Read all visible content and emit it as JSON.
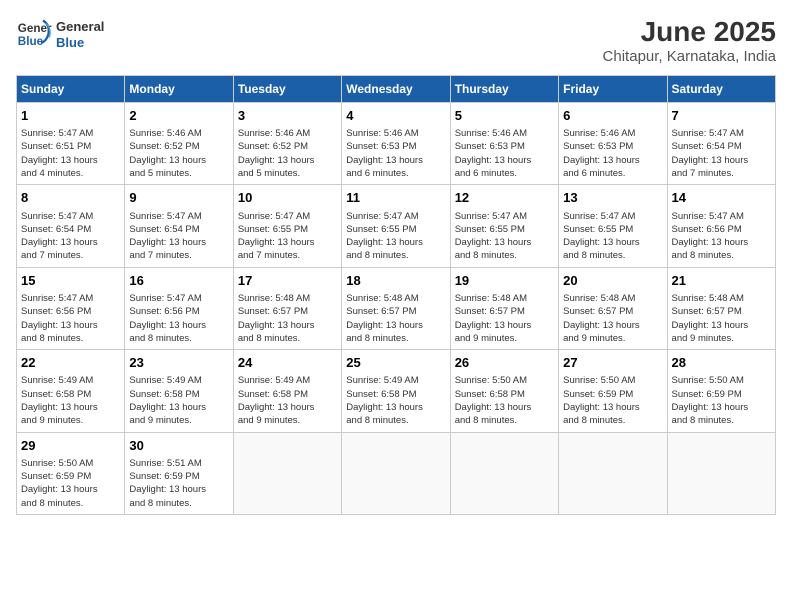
{
  "header": {
    "logo_line1": "General",
    "logo_line2": "Blue",
    "title": "June 2025",
    "subtitle": "Chitapur, Karnataka, India"
  },
  "calendar": {
    "weekdays": [
      "Sunday",
      "Monday",
      "Tuesday",
      "Wednesday",
      "Thursday",
      "Friday",
      "Saturday"
    ],
    "weeks": [
      [
        {
          "day": "1",
          "info": "Sunrise: 5:47 AM\nSunset: 6:51 PM\nDaylight: 13 hours\nand 4 minutes."
        },
        {
          "day": "2",
          "info": "Sunrise: 5:46 AM\nSunset: 6:52 PM\nDaylight: 13 hours\nand 5 minutes."
        },
        {
          "day": "3",
          "info": "Sunrise: 5:46 AM\nSunset: 6:52 PM\nDaylight: 13 hours\nand 5 minutes."
        },
        {
          "day": "4",
          "info": "Sunrise: 5:46 AM\nSunset: 6:53 PM\nDaylight: 13 hours\nand 6 minutes."
        },
        {
          "day": "5",
          "info": "Sunrise: 5:46 AM\nSunset: 6:53 PM\nDaylight: 13 hours\nand 6 minutes."
        },
        {
          "day": "6",
          "info": "Sunrise: 5:46 AM\nSunset: 6:53 PM\nDaylight: 13 hours\nand 6 minutes."
        },
        {
          "day": "7",
          "info": "Sunrise: 5:47 AM\nSunset: 6:54 PM\nDaylight: 13 hours\nand 7 minutes."
        }
      ],
      [
        {
          "day": "8",
          "info": "Sunrise: 5:47 AM\nSunset: 6:54 PM\nDaylight: 13 hours\nand 7 minutes."
        },
        {
          "day": "9",
          "info": "Sunrise: 5:47 AM\nSunset: 6:54 PM\nDaylight: 13 hours\nand 7 minutes."
        },
        {
          "day": "10",
          "info": "Sunrise: 5:47 AM\nSunset: 6:55 PM\nDaylight: 13 hours\nand 7 minutes."
        },
        {
          "day": "11",
          "info": "Sunrise: 5:47 AM\nSunset: 6:55 PM\nDaylight: 13 hours\nand 8 minutes."
        },
        {
          "day": "12",
          "info": "Sunrise: 5:47 AM\nSunset: 6:55 PM\nDaylight: 13 hours\nand 8 minutes."
        },
        {
          "day": "13",
          "info": "Sunrise: 5:47 AM\nSunset: 6:55 PM\nDaylight: 13 hours\nand 8 minutes."
        },
        {
          "day": "14",
          "info": "Sunrise: 5:47 AM\nSunset: 6:56 PM\nDaylight: 13 hours\nand 8 minutes."
        }
      ],
      [
        {
          "day": "15",
          "info": "Sunrise: 5:47 AM\nSunset: 6:56 PM\nDaylight: 13 hours\nand 8 minutes."
        },
        {
          "day": "16",
          "info": "Sunrise: 5:47 AM\nSunset: 6:56 PM\nDaylight: 13 hours\nand 8 minutes."
        },
        {
          "day": "17",
          "info": "Sunrise: 5:48 AM\nSunset: 6:57 PM\nDaylight: 13 hours\nand 8 minutes."
        },
        {
          "day": "18",
          "info": "Sunrise: 5:48 AM\nSunset: 6:57 PM\nDaylight: 13 hours\nand 8 minutes."
        },
        {
          "day": "19",
          "info": "Sunrise: 5:48 AM\nSunset: 6:57 PM\nDaylight: 13 hours\nand 9 minutes."
        },
        {
          "day": "20",
          "info": "Sunrise: 5:48 AM\nSunset: 6:57 PM\nDaylight: 13 hours\nand 9 minutes."
        },
        {
          "day": "21",
          "info": "Sunrise: 5:48 AM\nSunset: 6:57 PM\nDaylight: 13 hours\nand 9 minutes."
        }
      ],
      [
        {
          "day": "22",
          "info": "Sunrise: 5:49 AM\nSunset: 6:58 PM\nDaylight: 13 hours\nand 9 minutes."
        },
        {
          "day": "23",
          "info": "Sunrise: 5:49 AM\nSunset: 6:58 PM\nDaylight: 13 hours\nand 9 minutes."
        },
        {
          "day": "24",
          "info": "Sunrise: 5:49 AM\nSunset: 6:58 PM\nDaylight: 13 hours\nand 9 minutes."
        },
        {
          "day": "25",
          "info": "Sunrise: 5:49 AM\nSunset: 6:58 PM\nDaylight: 13 hours\nand 8 minutes."
        },
        {
          "day": "26",
          "info": "Sunrise: 5:50 AM\nSunset: 6:58 PM\nDaylight: 13 hours\nand 8 minutes."
        },
        {
          "day": "27",
          "info": "Sunrise: 5:50 AM\nSunset: 6:59 PM\nDaylight: 13 hours\nand 8 minutes."
        },
        {
          "day": "28",
          "info": "Sunrise: 5:50 AM\nSunset: 6:59 PM\nDaylight: 13 hours\nand 8 minutes."
        }
      ],
      [
        {
          "day": "29",
          "info": "Sunrise: 5:50 AM\nSunset: 6:59 PM\nDaylight: 13 hours\nand 8 minutes."
        },
        {
          "day": "30",
          "info": "Sunrise: 5:51 AM\nSunset: 6:59 PM\nDaylight: 13 hours\nand 8 minutes."
        },
        {
          "day": "",
          "info": ""
        },
        {
          "day": "",
          "info": ""
        },
        {
          "day": "",
          "info": ""
        },
        {
          "day": "",
          "info": ""
        },
        {
          "day": "",
          "info": ""
        }
      ]
    ]
  }
}
